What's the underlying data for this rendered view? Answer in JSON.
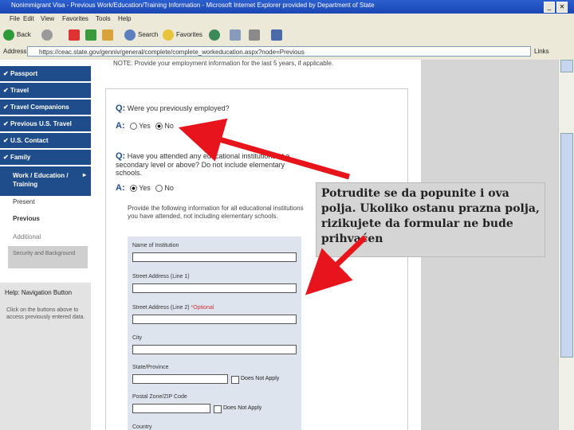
{
  "window": {
    "title": "Nonimmigrant Visa - Previous Work/Education/Training Information - Microsoft Internet Explorer provided by Department of State"
  },
  "menu": [
    "File",
    "Edit",
    "View",
    "Favorites",
    "Tools",
    "Help"
  ],
  "toolbar": {
    "back": "Back",
    "search": "Search",
    "favorites": "Favorites"
  },
  "address": {
    "label": "Address",
    "url": "https://ceac.state.gov/genniv/general/complete/complete_workeducation.aspx?node=Previous",
    "links": "Links"
  },
  "sidebar": {
    "items": [
      "Passport",
      "Travel",
      "Travel Companions",
      "Previous U.S. Travel",
      "U.S. Contact",
      "Family"
    ],
    "current": "Work / Education / Training",
    "subitems": [
      "Present",
      "Previous",
      "Additional",
      "Security and Background"
    ],
    "help_title": "Help: Navigation Button",
    "help_text": "Click on the buttons above to access previously entered data."
  },
  "main": {
    "note": "NOTE: Provide your employment information for the last 5 years, if applicable.",
    "q1": "Were you previously employed?",
    "q2": "Have you attended any educational institutions at a secondary level or above? Do not include elementary schools.",
    "q_marker": "Q:",
    "a_marker": "A:",
    "yes": "Yes",
    "no": "No",
    "instructions": "Provide the following information for all educational institutions you have attended, not including elementary schools.",
    "fields": {
      "name": "Name of Institution",
      "street1": "Street Address (Line 1)",
      "street2": "Street Address (Line 2)",
      "optional": "*Optional",
      "city": "City",
      "state": "State/Province",
      "postal": "Postal Zone/ZIP Code",
      "dna": "Does Not Apply",
      "country": "Country"
    }
  },
  "callout": {
    "text": "Potrudite se da popunite i ova polja. Ukoliko ostanu prazna polja, rizikujete da formular ne bude prihvaćen"
  },
  "colors": {
    "nav": "#1f4d8b",
    "arrow": "#e8141b",
    "titlebar": "#2356c4"
  }
}
